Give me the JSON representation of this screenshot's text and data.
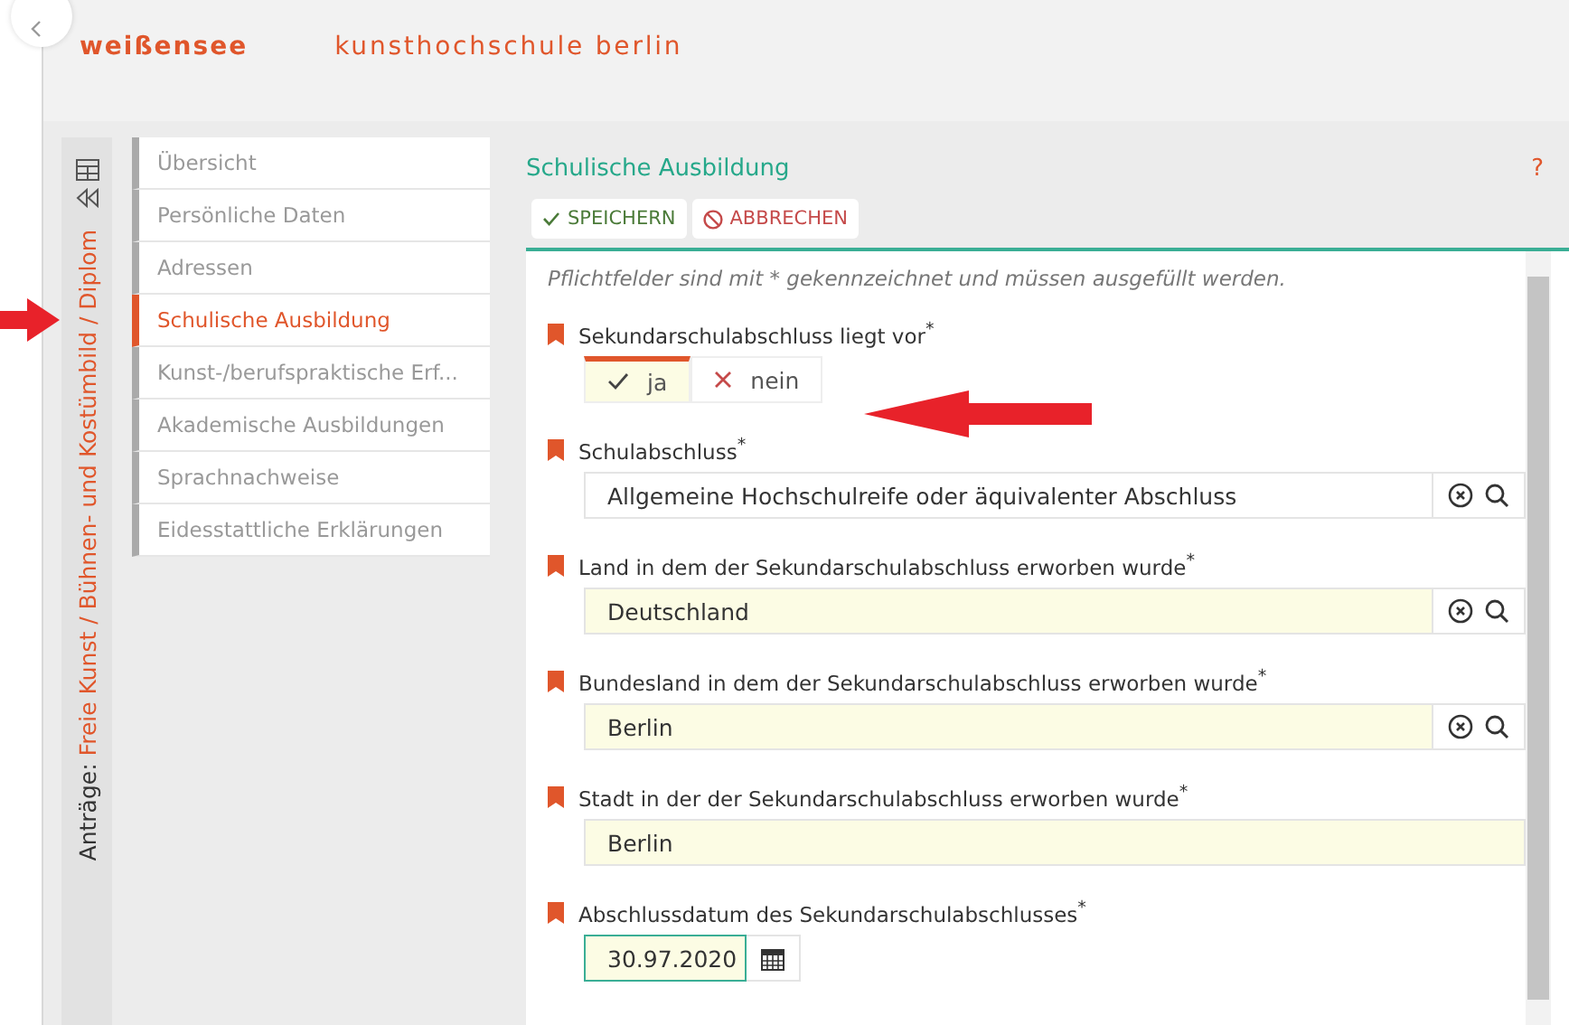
{
  "header": {
    "logo": "weißensee",
    "school": "kunsthochschule berlin"
  },
  "sidebar": {
    "prefix": "Anträge:",
    "application": "Freie Kunst / Bühnen- und Kostümbild / Diplom"
  },
  "nav": [
    {
      "label": "Übersicht",
      "selected": false
    },
    {
      "label": "Persönliche Daten",
      "selected": false
    },
    {
      "label": "Adressen",
      "selected": false
    },
    {
      "label": "Schulische Ausbildung",
      "selected": true
    },
    {
      "label": "Kunst-/berufspraktische Erf...",
      "selected": false
    },
    {
      "label": "Akademische Ausbildungen",
      "selected": false
    },
    {
      "label": "Sprachnachweise",
      "selected": false
    },
    {
      "label": "Eidesstattliche Erklärungen",
      "selected": false
    }
  ],
  "section": {
    "title": "Schulische Ausbildung",
    "help": "?"
  },
  "toolbar": [
    {
      "kind": "save",
      "label": "SPEICHERN"
    },
    {
      "kind": "cancel",
      "label": "ABBRECHEN"
    }
  ],
  "hint": "Pflichtfelder sind mit * gekennzeichnet und müssen ausgefüllt werden.",
  "fields": [
    {
      "kind": "toggle",
      "label": "Sekundarschulabschluss liegt vor",
      "options": [
        {
          "label": "ja",
          "selected": true
        },
        {
          "label": "nein",
          "selected": false
        }
      ]
    },
    {
      "kind": "lookup",
      "label": "Schulabschluss",
      "value": "Allgemeine Hochschulreife oder äquivalenter Abschluss",
      "filled": false
    },
    {
      "kind": "lookup",
      "label": "Land in dem der Sekundarschulabschluss erworben wurde",
      "value": "Deutschland",
      "filled": true
    },
    {
      "kind": "lookup",
      "label": "Bundesland in dem der Sekundarschulabschluss erworben wurde",
      "value": "Berlin",
      "filled": true
    },
    {
      "kind": "text",
      "label": "Stadt in der der Sekundarschulabschluss erworben wurde",
      "value": "Berlin",
      "filled": true
    },
    {
      "kind": "date",
      "label": "Abschlussdatum des Sekundarschulabschlusses",
      "value": "30.97.2020",
      "filled": true
    }
  ],
  "required_mark": "*"
}
